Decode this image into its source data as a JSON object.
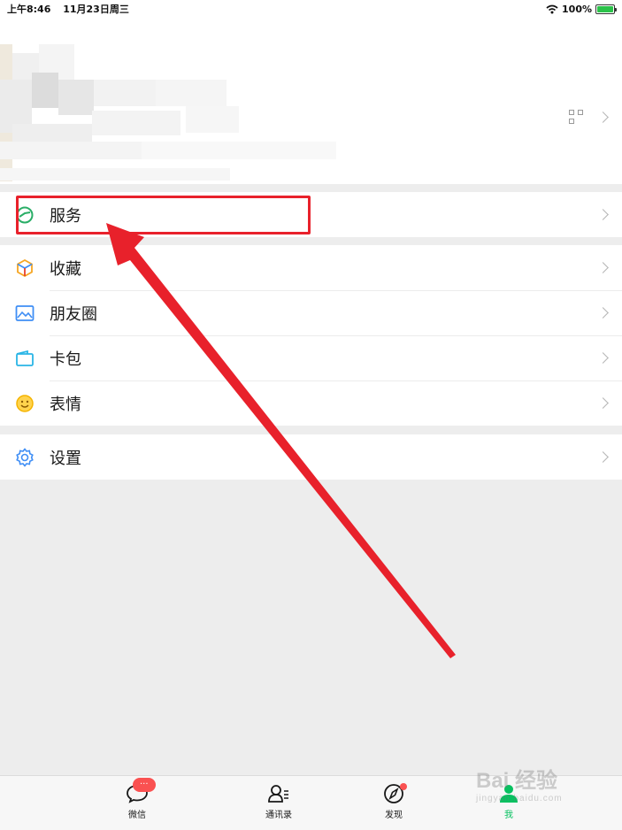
{
  "status_bar": {
    "time": "上午8:46",
    "date": "11月23日周三",
    "battery": "100%"
  },
  "menu": {
    "service": {
      "label": "服务",
      "icon": "service-icon"
    },
    "group2": [
      {
        "label": "收藏",
        "icon": "favorites-cube-icon"
      },
      {
        "label": "朋友圈",
        "icon": "moments-picture-icon"
      },
      {
        "label": "卡包",
        "icon": "card-wallet-icon"
      },
      {
        "label": "表情",
        "icon": "smiley-icon"
      }
    ],
    "settings": {
      "label": "设置",
      "icon": "gear-icon"
    }
  },
  "tabbar": {
    "tabs": [
      {
        "label": "微信",
        "badge": "···"
      },
      {
        "label": "通讯录"
      },
      {
        "label": "发现"
      },
      {
        "label": "我"
      }
    ]
  },
  "watermark": {
    "text": "Bai 经验",
    "sub": "jingyan.baidu.com"
  },
  "colors": {
    "accent": "#07c160",
    "annotation_red": "#e8212b",
    "badge": "#fa5151"
  }
}
